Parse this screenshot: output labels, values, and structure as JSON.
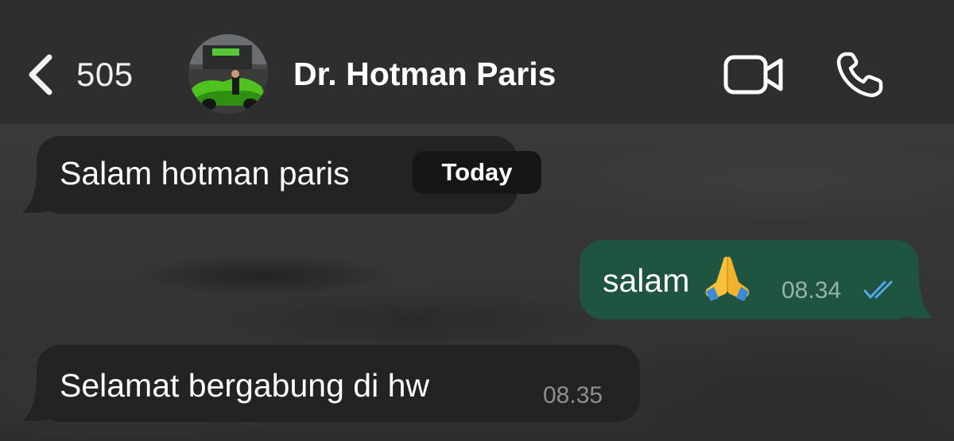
{
  "header": {
    "back_count": "505",
    "contact_name": "Dr. Hotman Paris",
    "back_icon": "chevron-left-icon",
    "video_icon": "video-camera-icon",
    "call_icon": "phone-icon"
  },
  "date_badge": "Today",
  "messages": [
    {
      "direction": "incoming",
      "text": "Salam hotman paris",
      "time": ""
    },
    {
      "direction": "outgoing",
      "text": "salam",
      "emoji": "folded-hands",
      "time": "08.34",
      "status": "read"
    },
    {
      "direction": "incoming",
      "text": "Selamat bergabung di hw",
      "time": "08.35"
    }
  ],
  "colors": {
    "header_bg": "#2f2e2e",
    "incoming_bubble": "#232323",
    "outgoing_bubble": "#1f5440",
    "read_tick": "#53a8e8",
    "timestamp": "#8e8e8e"
  }
}
